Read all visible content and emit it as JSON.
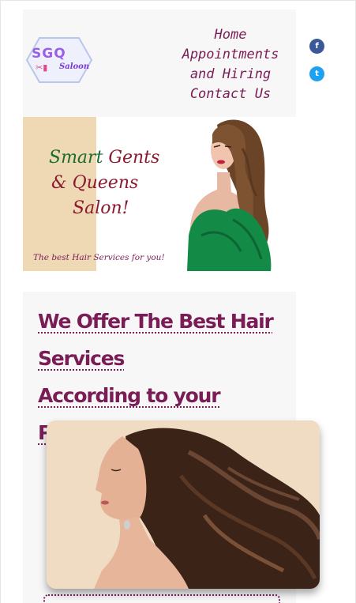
{
  "header": {
    "logo": {
      "primary": "SGQ",
      "secondary": "Saloon"
    },
    "nav": {
      "home": "Home",
      "appointments": "Appointments",
      "hiring": "and Hiring",
      "contact": "Contact Us"
    }
  },
  "social": {
    "facebook": "f",
    "twitter": "t"
  },
  "hero": {
    "title_part1": "Smart",
    "title_part2": "Gents",
    "title_part3": "& Queens",
    "title_part4": "Salon!",
    "tagline": "The best Hair Services for you!"
  },
  "services": {
    "heading_line1": "We Offer The Best Hair",
    "heading_line2": "Services",
    "heading_line3": "According to your Preferences"
  },
  "colors": {
    "brand": "#7a1c55",
    "header_bg": "#f7f7f7",
    "hero_accent": "#efd9b4",
    "facebook": "#3b5998",
    "twitter": "#1da1f2"
  }
}
